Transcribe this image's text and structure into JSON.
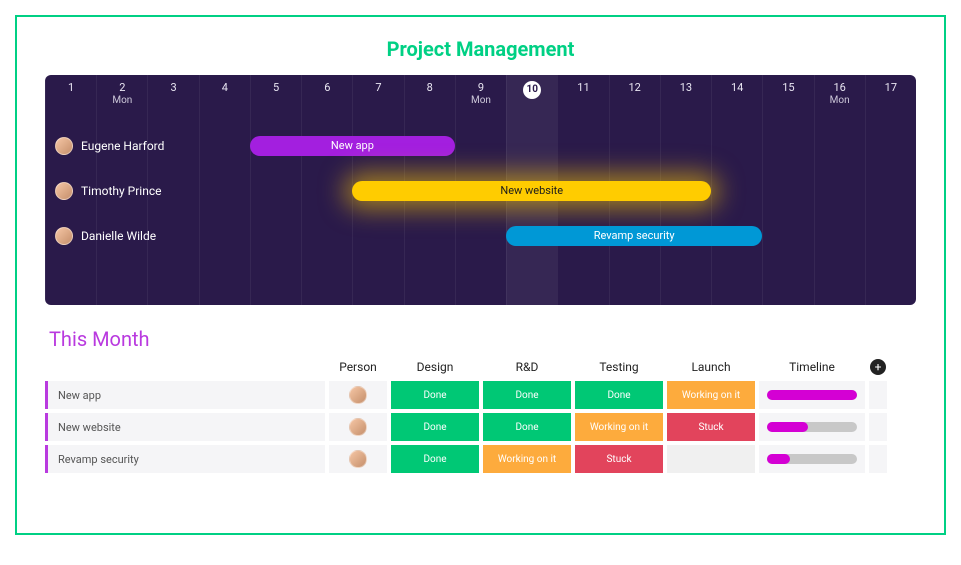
{
  "title": "Project Management",
  "gantt": {
    "days": [
      {
        "n": "1"
      },
      {
        "n": "2",
        "sub": "Mon"
      },
      {
        "n": "3"
      },
      {
        "n": "4"
      },
      {
        "n": "5"
      },
      {
        "n": "6"
      },
      {
        "n": "7"
      },
      {
        "n": "8"
      },
      {
        "n": "9",
        "sub": "Mon"
      },
      {
        "n": "10",
        "today": true
      },
      {
        "n": "11"
      },
      {
        "n": "12"
      },
      {
        "n": "13"
      },
      {
        "n": "14"
      },
      {
        "n": "15"
      },
      {
        "n": "16",
        "sub": "Mon"
      },
      {
        "n": "17"
      }
    ],
    "rows": [
      {
        "name": "Eugene Harford",
        "bar": {
          "label": "New app",
          "color": "purple",
          "start": 5,
          "end": 8
        }
      },
      {
        "name": "Timothy Prince",
        "bar": {
          "label": "New website",
          "color": "yellow",
          "start": 7,
          "end": 13
        }
      },
      {
        "name": "Danielle Wilde",
        "bar": {
          "label": "Revamp security",
          "color": "blue",
          "start": 10,
          "end": 14
        }
      }
    ]
  },
  "table": {
    "title": "This Month",
    "headers": {
      "person": "Person",
      "design": "Design",
      "rnd": "R&D",
      "testing": "Testing",
      "launch": "Launch",
      "timeline": "Timeline"
    },
    "statusLabels": {
      "done": "Done",
      "work": "Working on it",
      "stuck": "Stuck",
      "empty": ""
    },
    "rows": [
      {
        "name": "New app",
        "design": "done",
        "rnd": "done",
        "testing": "done",
        "launch": "work",
        "progress": 100
      },
      {
        "name": "New website",
        "design": "done",
        "rnd": "done",
        "testing": "work",
        "launch": "stuck",
        "progress": 45
      },
      {
        "name": "Revamp security",
        "design": "done",
        "rnd": "work",
        "testing": "stuck",
        "launch": "empty",
        "progress": 25
      }
    ]
  }
}
